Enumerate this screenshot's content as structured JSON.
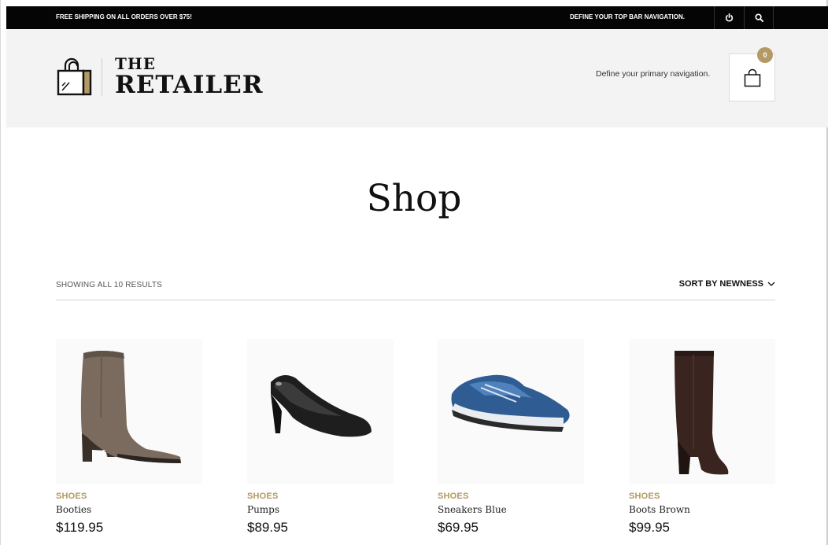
{
  "topbar": {
    "promo": "FREE SHIPPING ON ALL ORDERS OVER $75!",
    "nav_text": "DEFINE YOUR TOP BAR NAVIGATION.",
    "power_icon": "power-icon",
    "search_icon": "search-icon"
  },
  "header": {
    "logo_line1": "THE",
    "logo_line2": "RETAILER",
    "primary_nav": "Define your primary navigation.",
    "cart_count": "0",
    "cart_icon": "shopping-bag-icon"
  },
  "page": {
    "title": "Shop"
  },
  "toolbar": {
    "results": "SHOWING ALL 10 RESULTS",
    "sort": "SORT BY NEWNESS"
  },
  "products": [
    {
      "category": "SHOES",
      "name": "Booties",
      "price": "$119.95"
    },
    {
      "category": "SHOES",
      "name": "Pumps",
      "price": "$89.95"
    },
    {
      "category": "SHOES",
      "name": "Sneakers Blue",
      "price": "$69.95"
    },
    {
      "category": "SHOES",
      "name": "Boots Brown",
      "price": "$99.95"
    }
  ],
  "colors": {
    "accent": "#b39964",
    "topbar": "#050505",
    "header": "#f3f3f3"
  }
}
